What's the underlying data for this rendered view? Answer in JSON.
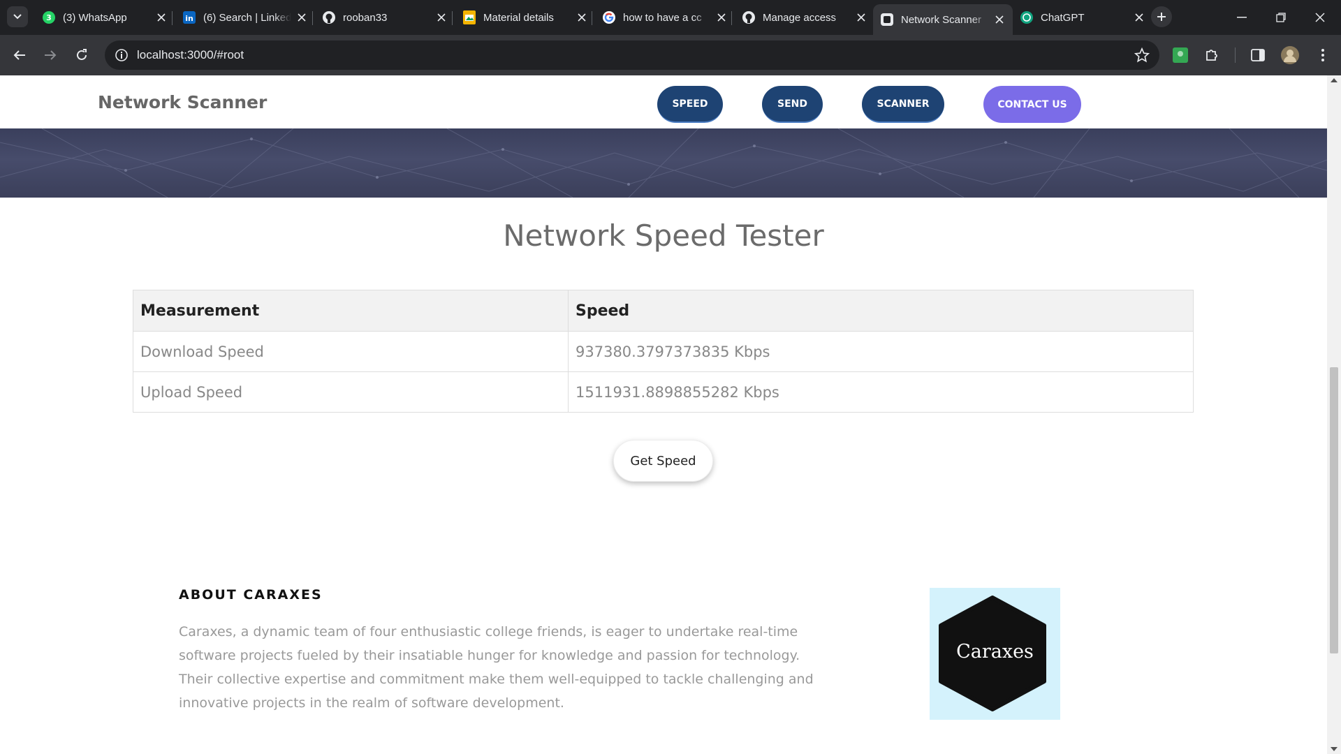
{
  "browser": {
    "tabs": [
      {
        "title": "(3) WhatsApp",
        "icon": "whatsapp-icon",
        "active": false
      },
      {
        "title": "(6) Search | LinkedIn",
        "icon": "linkedin-icon",
        "active": false
      },
      {
        "title": "rooban33",
        "icon": "github-icon",
        "active": false
      },
      {
        "title": "Material details",
        "icon": "slides-icon",
        "active": false
      },
      {
        "title": "how to have a cc",
        "icon": "google-icon",
        "active": false
      },
      {
        "title": "Manage access",
        "icon": "github-icon",
        "active": false
      },
      {
        "title": "Network Scanner",
        "icon": "react-app-icon",
        "active": true
      },
      {
        "title": "ChatGPT",
        "icon": "chatgpt-icon",
        "active": false
      }
    ],
    "url": "localhost:3000/#root",
    "colors": {
      "frame": "#202124",
      "toolbar": "#35363a"
    }
  },
  "site": {
    "brand": "Network Scanner",
    "nav": [
      {
        "label": "SPEED"
      },
      {
        "label": "SEND"
      },
      {
        "label": "SCANNER"
      },
      {
        "label": "CONTACT US"
      }
    ],
    "colors": {
      "nav_pill": "#1e4373",
      "contact_pill": "#7b6ce8"
    }
  },
  "speed_tester": {
    "title": "Network Speed Tester",
    "headers": {
      "measurement": "Measurement",
      "speed": "Speed"
    },
    "rows": [
      {
        "measurement": "Download Speed",
        "speed": "937380.3797373835 Kbps"
      },
      {
        "measurement": "Upload Speed",
        "speed": "1511931.8898855282 Kbps"
      }
    ],
    "button_label": "Get Speed"
  },
  "about": {
    "title": "ABOUT CARAXES",
    "text": "Caraxes, a dynamic team of four enthusiastic college friends, is eager to undertake real-time software projects fueled by their insatiable hunger for knowledge and passion for technology. Their collective expertise and commitment make them well-equipped to tackle challenging and innovative projects in the realm of software development.",
    "logo_text": "Caraxes",
    "logo_bg": "#d4f2fc"
  }
}
